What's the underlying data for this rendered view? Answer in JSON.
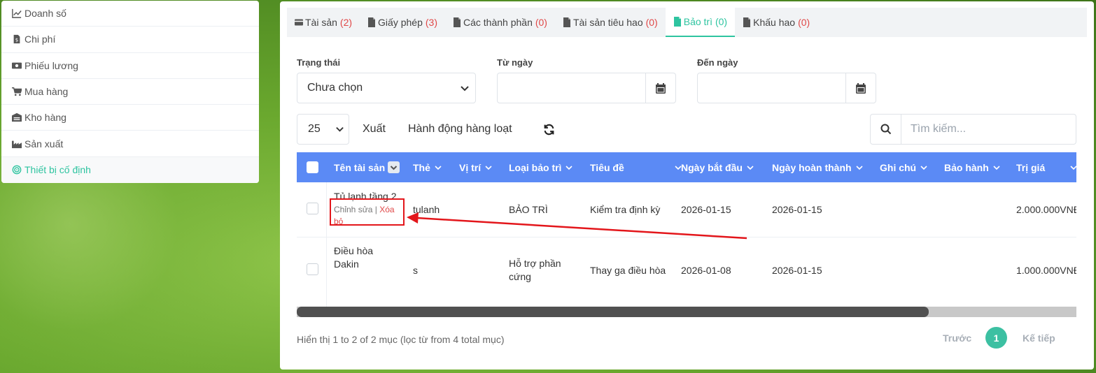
{
  "sidebar": {
    "items": [
      {
        "label": "Doanh số",
        "icon": "line-chart-icon"
      },
      {
        "label": "Chi phí",
        "icon": "file-invoice-icon"
      },
      {
        "label": "Phiếu lương",
        "icon": "money-bill-icon"
      },
      {
        "label": "Mua hàng",
        "icon": "cart-icon"
      },
      {
        "label": "Kho hàng",
        "icon": "warehouse-icon"
      },
      {
        "label": "Sản xuất",
        "icon": "industry-icon"
      },
      {
        "label": "Thiết bị cố định",
        "icon": "target-icon",
        "active": true
      }
    ]
  },
  "tabs": [
    {
      "label": "Tài sản",
      "count": "(2)",
      "icon": "credit-card-icon"
    },
    {
      "label": "Giấy phép",
      "count": "(3)",
      "icon": "file-icon"
    },
    {
      "label": "Các thành phần",
      "count": "(0)",
      "icon": "file-icon"
    },
    {
      "label": "Tài sản tiêu hao",
      "count": "(0)",
      "icon": "file-icon"
    },
    {
      "label": "Bảo trì",
      "count": "(0)",
      "icon": "file-icon",
      "active": true
    },
    {
      "label": "Khấu hao",
      "count": "(0)",
      "icon": "file-icon"
    }
  ],
  "filters": {
    "status_label": "Trạng thái",
    "status_value": "Chưa chọn",
    "from_label": "Từ ngày",
    "to_label": "Đến ngày"
  },
  "toolbar": {
    "page_size": "25",
    "export_label": "Xuất",
    "bulk_label": "Hành động hàng loạt",
    "search_placeholder": "Tìm kiếm..."
  },
  "table": {
    "columns": [
      "Tên tài sản",
      "Thẻ",
      "Vị trí",
      "Loại bảo trì",
      "Tiêu đề",
      "Ngày bắt đầu",
      "Ngày hoàn thành",
      "Ghi chú",
      "Bảo hành",
      "Trị giá"
    ],
    "rows": [
      {
        "name": "Tủ lạnh tầng 2",
        "tag": "tulanh",
        "location": "",
        "type": "BẢO TRÌ",
        "title": "Kiểm tra định kỳ",
        "start": "2026-01-15",
        "end": "2026-01-15",
        "note": "",
        "warranty": "",
        "value": "2.000.000VNĐ",
        "edit_label": "Chỉnh sửa",
        "sep": "|",
        "delete_label": "Xóa bỏ"
      },
      {
        "name_line1": "Điều hòa",
        "name_line2": "Dakin",
        "tag": "s",
        "location": "",
        "type_line1": "Hỗ trợ phần",
        "type_line2": "cứng",
        "title": "Thay ga điều hòa",
        "start": "2026-01-08",
        "end": "2026-01-15",
        "note": "",
        "warranty": "",
        "value": "1.000.000VNĐ"
      }
    ]
  },
  "footer": {
    "info": "Hiển thị 1 to 2 of 2 mục (lọc từ from 4 total mục)",
    "prev": "Trước",
    "current_page": "1",
    "next": "Kế tiếp"
  },
  "colors": {
    "accent": "#2ec4a0",
    "header_blue": "#5b8af5",
    "count_red": "#e04848",
    "annotation_red": "#e3161b"
  }
}
